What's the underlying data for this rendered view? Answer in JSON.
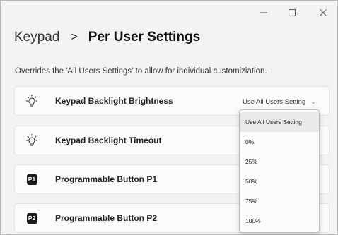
{
  "window": {
    "minimize_icon": "minimize-icon",
    "maximize_icon": "maximize-icon",
    "close_icon": "close-icon"
  },
  "breadcrumb": {
    "root": "Keypad",
    "separator": ">",
    "current": "Per User Settings"
  },
  "description": "Overrides the 'All Users Settings' to allow for individual customiziation.",
  "settings": [
    {
      "icon": "lightbulb-icon",
      "label": "Keypad Backlight Brightness",
      "value": "Use All Users Setting"
    },
    {
      "icon": "lightbulb-icon",
      "label": "Keypad Backlight Timeout"
    },
    {
      "icon": "p1-badge-icon",
      "badge": "P1",
      "label": "Programmable Button P1"
    },
    {
      "icon": "p2-badge-icon",
      "badge": "P2",
      "label": "Programmable Button P2"
    }
  ],
  "dropdown": {
    "options": [
      "Use All Users Setting",
      "0%",
      "25%",
      "50%",
      "75%",
      "100%"
    ],
    "selected": "Use All Users Setting"
  }
}
